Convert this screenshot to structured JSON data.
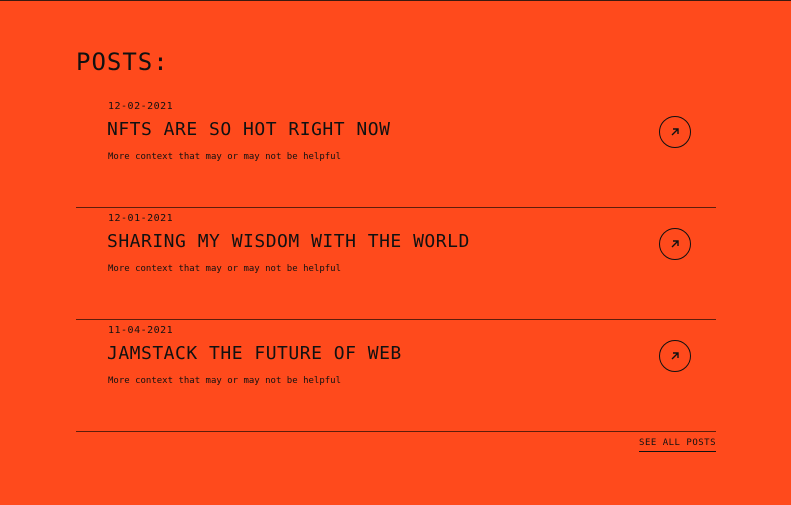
{
  "section": {
    "title": "POSTS:"
  },
  "posts": [
    {
      "date": "12-02-2021",
      "title": "NFTS ARE SO HOT RIGHT NOW",
      "description": "More context that may or may not be helpful",
      "link_icon": "arrow-up-right-icon"
    },
    {
      "date": "12-01-2021",
      "title": "SHARING MY WISDOM WITH THE WORLD",
      "description": "More context that may or may not be helpful",
      "link_icon": "arrow-up-right-icon"
    },
    {
      "date": "11-04-2021",
      "title": "JAMSTACK THE FUTURE OF WEB",
      "description": "More context that may or may not be helpful",
      "link_icon": "arrow-up-right-icon"
    }
  ],
  "footer": {
    "see_all_label": "SEE ALL POSTS"
  },
  "colors": {
    "background": "#FF4A1C",
    "text": "#111111"
  }
}
